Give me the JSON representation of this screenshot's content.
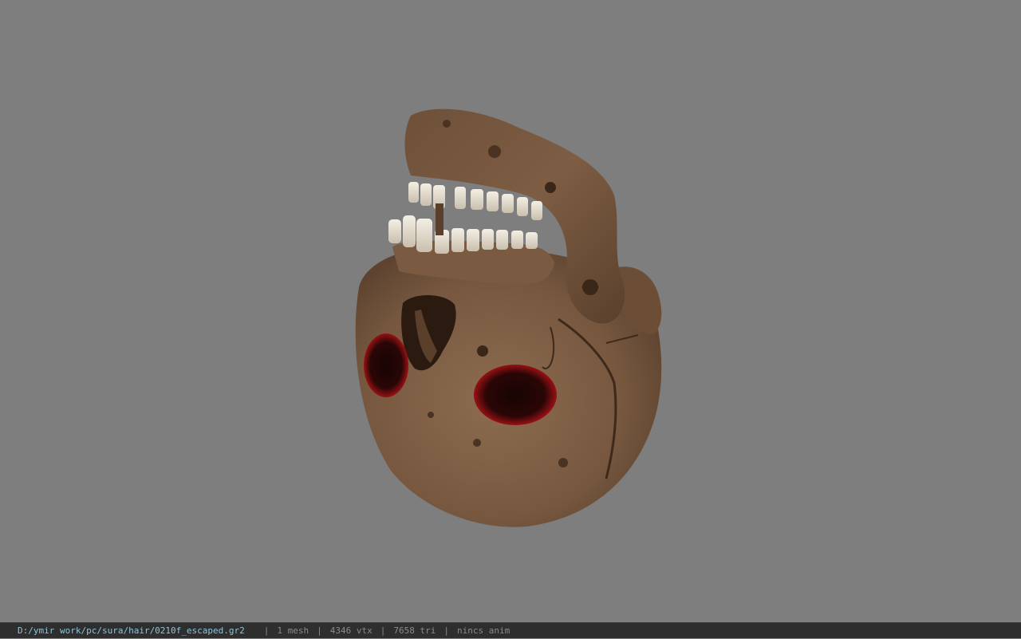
{
  "viewport": {
    "background_color": "#7e7e7e",
    "model_subject": "skull",
    "bone_color": "#7e5f45",
    "teeth_color": "#e9e3d6",
    "socket_color": "#c0141a"
  },
  "status_bar": {
    "file_path": "D:/ymir work/pc/sura/hair/0210f_escaped.gr2",
    "separator": "|",
    "mesh_count": "1 mesh",
    "vertex_count": "4346 vtx",
    "triangle_count": "7658 tri",
    "animation": "nincs anim"
  }
}
